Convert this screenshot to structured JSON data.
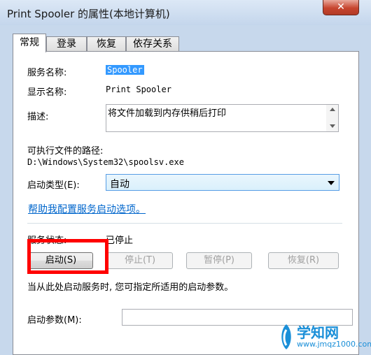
{
  "window": {
    "title": "Print Spooler 的属性(本地计算机)",
    "close_glyph": "✕"
  },
  "tabs": [
    {
      "label": "常规"
    },
    {
      "label": "登录"
    },
    {
      "label": "恢复"
    },
    {
      "label": "依存关系"
    }
  ],
  "general": {
    "service_name_label": "服务名称:",
    "service_name_value": "Spooler",
    "display_name_label": "显示名称:",
    "display_name_value": "Print Spooler",
    "description_label": "描述:",
    "description_value": "将文件加载到内存供稍后打印",
    "exe_path_label": "可执行文件的路径:",
    "exe_path_value": "D:\\Windows\\System32\\spoolsv.exe",
    "startup_type_label": "启动类型(E):",
    "startup_type_value": "自动",
    "help_link": "帮助我配置服务启动选项。",
    "status_label": "服务状态:",
    "status_value": "已停止",
    "buttons": {
      "start": "启动(S)",
      "stop": "停止(T)",
      "pause": "暂停(P)",
      "resume": "恢复(R)"
    },
    "hint_text": "当从此处启动服务时, 您可指定所适用的启动参数。",
    "start_params_label": "启动参数(M):",
    "start_params_value": ""
  },
  "watermark": {
    "brand": "学知网",
    "url": "www.jmqz1000.com"
  },
  "colors": {
    "selection": "#3399ff",
    "link": "#0066cc",
    "highlight_box": "#ff0000",
    "close_button": "#c7452f"
  }
}
